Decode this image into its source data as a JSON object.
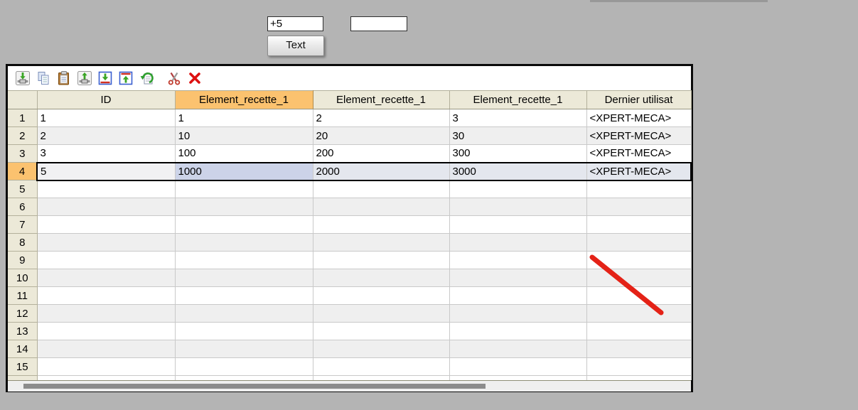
{
  "colors": {
    "page_bg": "#b4b4b4",
    "header_bg": "#ece9d8",
    "highlight_orange": "#fbc26f",
    "selected_cell_blue": "#ccd3e8",
    "selected_row_tint": "#e4e7ee",
    "even_row": "#efefef",
    "annotation_red": "#e42217"
  },
  "top_controls": {
    "input1": {
      "value": "+5",
      "placeholder": ""
    },
    "input2": {
      "value": "",
      "placeholder": ""
    },
    "text_button": {
      "label": "Text"
    }
  },
  "toolbar": {
    "icons": [
      {
        "name": "import-into-table-icon"
      },
      {
        "name": "copy-icon"
      },
      {
        "name": "paste-icon"
      },
      {
        "name": "export-from-table-icon"
      },
      {
        "name": "insert-row-below-icon"
      },
      {
        "name": "insert-row-above-icon"
      },
      {
        "name": "revert-icon"
      },
      {
        "name": "cut-icon"
      },
      {
        "name": "delete-icon"
      }
    ]
  },
  "grid": {
    "columns": [
      {
        "label": "",
        "width": 41
      },
      {
        "label": "ID",
        "width": 194
      },
      {
        "label": "Element_recette_1",
        "width": 194,
        "highlighted": true
      },
      {
        "label": "Element_recette_1",
        "width": 192
      },
      {
        "label": "Element_recette_1",
        "width": 193
      },
      {
        "label": "Dernier utilisat",
        "width": 147,
        "clipped": true
      }
    ],
    "rows": [
      {
        "num": "1",
        "cells": [
          "1",
          "1",
          "2",
          "3",
          "<XPERT-MECA>"
        ]
      },
      {
        "num": "2",
        "cells": [
          "2",
          "10",
          "20",
          "30",
          "<XPERT-MECA>"
        ]
      },
      {
        "num": "3",
        "cells": [
          "3",
          "100",
          "200",
          "300",
          "<XPERT-MECA>"
        ]
      },
      {
        "num": "4",
        "cells": [
          "5",
          "1000",
          "2000",
          "3000",
          "<XPERT-MECA>"
        ],
        "selected": true,
        "active_cell_index": 1
      },
      {
        "num": "5",
        "cells": [
          "",
          "",
          "",
          "",
          ""
        ]
      },
      {
        "num": "6",
        "cells": [
          "",
          "",
          "",
          "",
          ""
        ]
      },
      {
        "num": "7",
        "cells": [
          "",
          "",
          "",
          "",
          ""
        ]
      },
      {
        "num": "8",
        "cells": [
          "",
          "",
          "",
          "",
          ""
        ]
      },
      {
        "num": "9",
        "cells": [
          "",
          "",
          "",
          "",
          ""
        ]
      },
      {
        "num": "10",
        "cells": [
          "",
          "",
          "",
          "",
          ""
        ]
      },
      {
        "num": "11",
        "cells": [
          "",
          "",
          "",
          "",
          ""
        ]
      },
      {
        "num": "12",
        "cells": [
          "",
          "",
          "",
          "",
          ""
        ]
      },
      {
        "num": "13",
        "cells": [
          "",
          "",
          "",
          "",
          ""
        ]
      },
      {
        "num": "14",
        "cells": [
          "",
          "",
          "",
          "",
          ""
        ]
      },
      {
        "num": "15",
        "cells": [
          "",
          "",
          "",
          "",
          ""
        ]
      }
    ]
  },
  "annotation": {
    "shape": "red-diagonal-line",
    "color": "#e42217"
  }
}
